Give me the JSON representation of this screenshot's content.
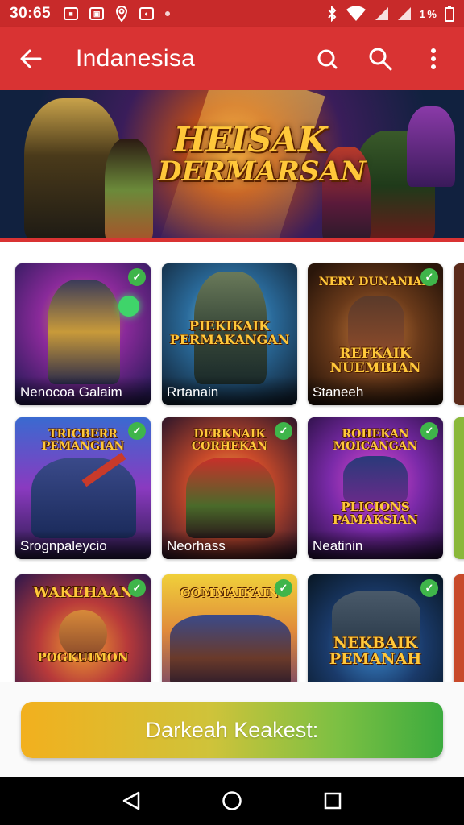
{
  "status_bar": {
    "time": "30:65",
    "battery": "1 %"
  },
  "app_bar": {
    "title": "Indanesisa",
    "back_icon": "arrow-left-icon",
    "icons": [
      "refresh-search-icon",
      "search-icon",
      "more-vert-icon"
    ]
  },
  "banner": {
    "title_line1": "HEISAK",
    "title_line2": "DERMARSAN"
  },
  "games": [
    {
      "label": "Nenocoa Galaim",
      "art_text": "",
      "checked": true
    },
    {
      "label": "Rrtanain",
      "art_text": "PIEKIKAIK PERMAKANGAN",
      "checked": false
    },
    {
      "label": "Staneeh",
      "art_text": "REFKAIK NUEMBIAN",
      "art_top": "NERY DUNANIAN",
      "checked": true
    },
    {
      "label": "Srognpaleycio",
      "art_text": "",
      "art_top": "TRICBERR PEMANGIAN",
      "checked": true
    },
    {
      "label": "Neorhass",
      "art_text": "",
      "art_top": "DERKNAIK CORHEKAN",
      "checked": true
    },
    {
      "label": "Neatinin",
      "art_text": "PLICIONS PAMAKSIAN",
      "art_top": "ROHEKAN MOICANGAN",
      "checked": true
    },
    {
      "label": "",
      "art_text": "POGKUIMON",
      "art_top": "WAKEHAAN",
      "checked": true
    },
    {
      "label": "",
      "art_text": "",
      "art_top": "GOMMAIKAIN",
      "checked": true
    },
    {
      "label": "",
      "art_text": "NEKBAIK PEMANAH",
      "checked": true
    }
  ],
  "cta": {
    "label": "Darkeah Keakest:"
  },
  "nav": {
    "icons": [
      "back-triangle-icon",
      "home-circle-icon",
      "recents-square-icon"
    ]
  },
  "colors": {
    "primary": "#d93333",
    "status": "#c82a2a",
    "check": "#3fb54a",
    "cta_start": "#f2b01e",
    "cta_end": "#3cab3e"
  }
}
